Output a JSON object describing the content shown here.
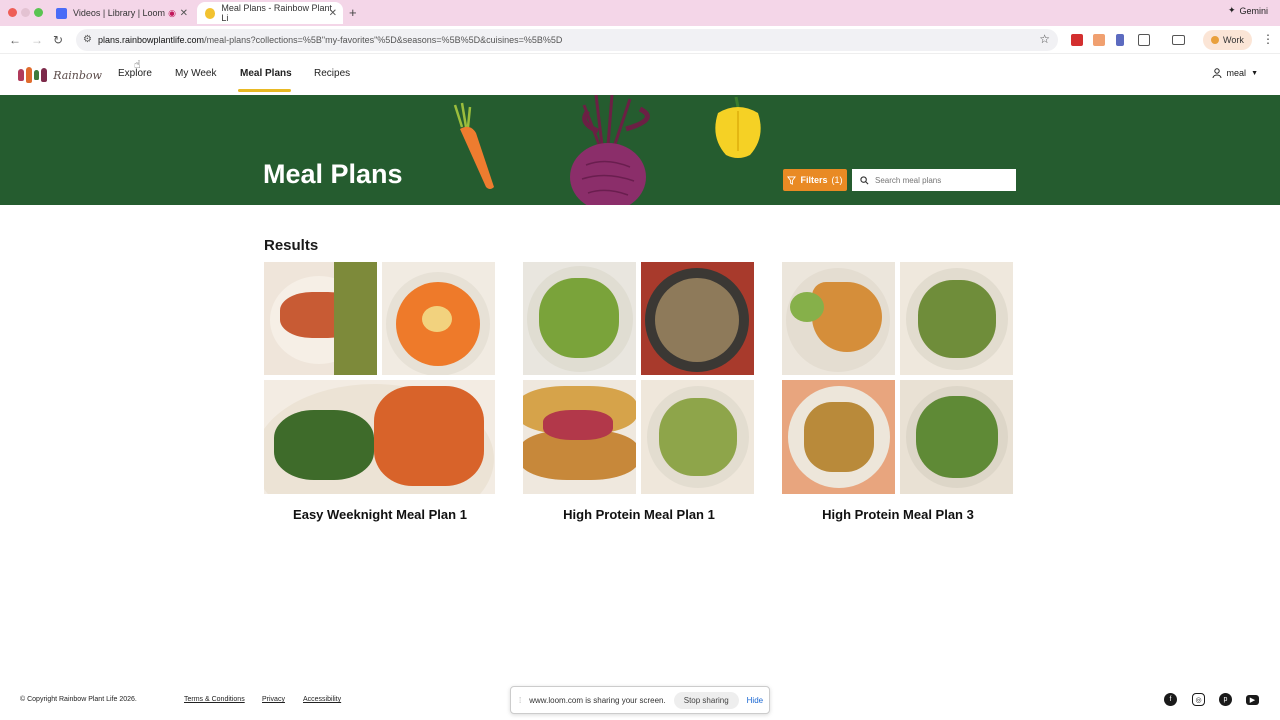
{
  "browser": {
    "tabs": [
      {
        "title": "Videos | Library | Loom",
        "active": false
      },
      {
        "title": "Meal Plans - Rainbow Plant Li",
        "active": true
      }
    ],
    "new_tab": "+",
    "gemini_label": "Gemini",
    "url_host": "plans.rainbowplantlife.com",
    "url_path": "/meal-plans?collections=%5B\"my-favorites\"%5D&seasons=%5B%5D&cuisines=%5B%5D",
    "profile_label": "Work"
  },
  "header": {
    "logo_text": "Rainbow",
    "nav": [
      {
        "label": "Explore",
        "active": false
      },
      {
        "label": "My Week",
        "active": false
      },
      {
        "label": "Meal Plans",
        "active": true
      },
      {
        "label": "Recipes",
        "active": false
      }
    ],
    "user_label": "meal"
  },
  "hero": {
    "title": "Meal Plans",
    "filters_label": "Filters",
    "filters_count": "(1)",
    "search_placeholder": "Search meal plans"
  },
  "results": {
    "heading": "Results",
    "plans": [
      {
        "title": "Easy Weeknight Meal Plan 1"
      },
      {
        "title": "High Protein Meal Plan 1"
      },
      {
        "title": "High Protein Meal Plan 3"
      }
    ]
  },
  "footer": {
    "copyright": "© Copyright Rainbow Plant Life 2026.",
    "links": [
      "Terms & Conditions",
      "Privacy",
      "Accessibility"
    ],
    "share_text": "www.loom.com is sharing your screen.",
    "stop_sharing": "Stop sharing",
    "hide": "Hide"
  },
  "colors": {
    "hero_bg": "#255c2f",
    "accent_orange": "#e98a24",
    "nav_underline": "#e8b924"
  }
}
